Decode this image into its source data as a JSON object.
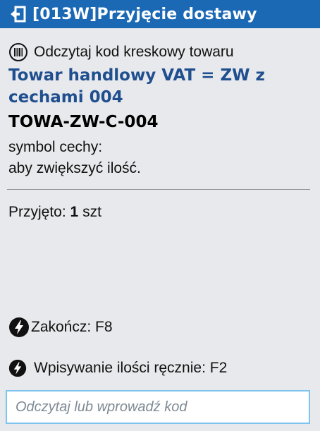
{
  "header": {
    "title": "[013W]Przyjęcie dostawy",
    "back_icon": "back-arrow-icon",
    "background_color": "#1b68b5"
  },
  "prompt": {
    "icon": "barcode-icon",
    "text": "Odczytaj kod kreskowy towaru"
  },
  "product": {
    "name": "Towar handlowy VAT = ZW z cechami 004",
    "code": "TOWA-ZW-C-004",
    "name_color": "#1f4f8f"
  },
  "info": {
    "line1": "symbol cechy:",
    "line2": "aby zwiększyć ilość."
  },
  "received": {
    "label": "Przyjęto:",
    "quantity": "1",
    "unit": "szt"
  },
  "actions": {
    "finish": {
      "icon": "lightning-icon",
      "label": "Zakończ: F8"
    },
    "manual": {
      "icon": "lightning-icon",
      "label": "Wpisywanie ilości ręcznie: F2"
    }
  },
  "code_input": {
    "value": "",
    "placeholder": "Odczytaj lub wprowadź kod",
    "border_color": "#7fc4ef"
  }
}
